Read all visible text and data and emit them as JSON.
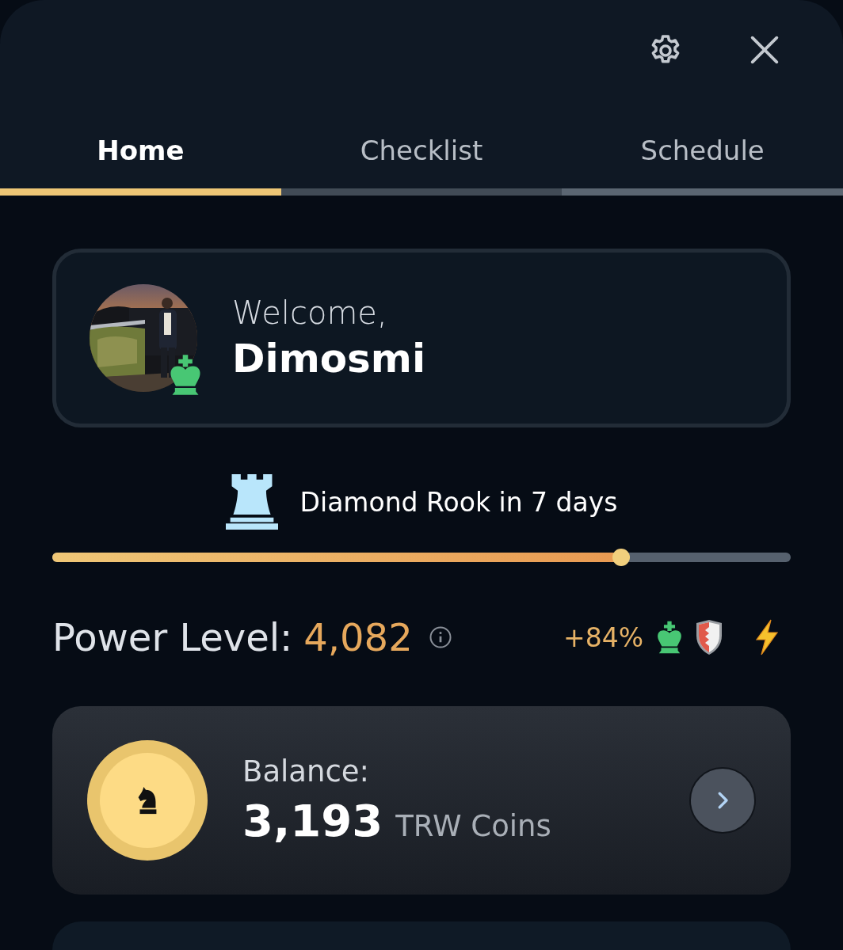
{
  "tabs": [
    {
      "label": "Home",
      "selected": true
    },
    {
      "label": "Checklist",
      "selected": false
    },
    {
      "label": "Schedule",
      "selected": false
    }
  ],
  "welcome": {
    "greeting": "Welcome,",
    "name": "Dimosmi"
  },
  "rank": {
    "label": "Diamond Rook in 7 days",
    "level": 0.77
  },
  "power": {
    "label": "Power Level:",
    "value": "4,082",
    "boost": "+84%"
  },
  "balance": {
    "label": "Balance:",
    "amount": "3,193",
    "unit": "TRW Coins"
  }
}
